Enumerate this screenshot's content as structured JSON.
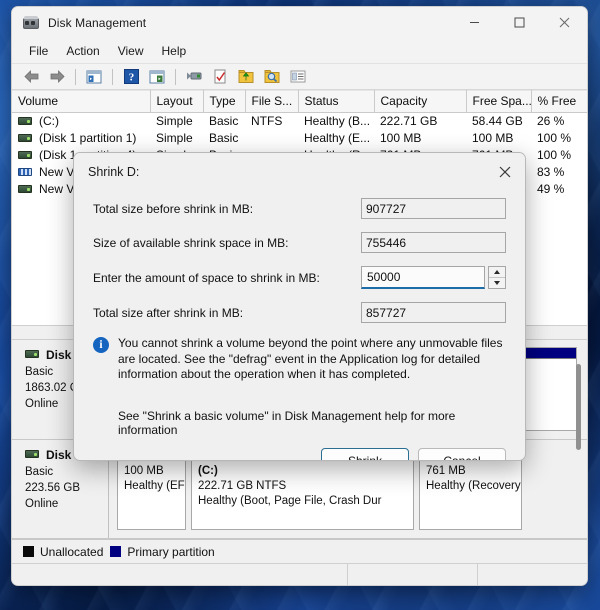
{
  "window": {
    "title": "Disk Management",
    "icon": "disk-management-icon",
    "controls": {
      "minimize": "minimize-icon",
      "maximize": "maximize-icon",
      "close": "close-icon"
    }
  },
  "menubar": {
    "items": [
      "File",
      "Action",
      "View",
      "Help"
    ]
  },
  "toolbar": {
    "buttons": [
      {
        "name": "back-icon"
      },
      {
        "name": "forward-icon"
      },
      {
        "name": "separator"
      },
      {
        "name": "show-hide-console-tree-icon"
      },
      {
        "name": "separator"
      },
      {
        "name": "help-icon"
      },
      {
        "name": "show-hide-action-pane-icon"
      },
      {
        "name": "separator"
      },
      {
        "name": "properties-icon"
      },
      {
        "name": "refresh-icon"
      },
      {
        "name": "rescan-disks-icon"
      },
      {
        "name": "search-icon"
      },
      {
        "name": "list-view-icon"
      }
    ]
  },
  "volume_list": {
    "columns": [
      "Volume",
      "Layout",
      "Type",
      "File S...",
      "Status",
      "Capacity",
      "Free Spa...",
      "% Free"
    ],
    "rows": [
      {
        "volume": "(C:)",
        "icon": "volume-icon",
        "layout": "Simple",
        "type": "Basic",
        "filesystem": "NTFS",
        "status": "Healthy (B...",
        "capacity": "222.71 GB",
        "free_space": "58.44 GB",
        "percent_free": "26 %"
      },
      {
        "volume": "(Disk 1 partition 1)",
        "icon": "volume-icon",
        "layout": "Simple",
        "type": "Basic",
        "filesystem": "",
        "status": "Healthy (E...",
        "capacity": "100 MB",
        "free_space": "100 MB",
        "percent_free": "100 %"
      },
      {
        "volume": "(Disk 1 partition 4)",
        "icon": "volume-icon",
        "layout": "Simple",
        "type": "Basic",
        "filesystem": "",
        "status": "Healthy (R...",
        "capacity": "761 MB",
        "free_space": "761 MB",
        "percent_free": "100 %"
      },
      {
        "volume": "New Vol",
        "icon": "volume-icon-striped",
        "layout": "",
        "type": "",
        "filesystem": "",
        "status": "",
        "capacity": "",
        "free_space": "",
        "percent_free": "83 %"
      },
      {
        "volume": "New Vol",
        "icon": "volume-icon",
        "layout": "",
        "type": "",
        "filesystem": "",
        "status": "",
        "capacity": "",
        "free_space": "",
        "percent_free": "49 %"
      }
    ]
  },
  "disk_view": {
    "disks": [
      {
        "name": "Disk 0",
        "type": "Basic",
        "size": "1863.02 GB",
        "state": "Online",
        "partitions": []
      },
      {
        "name": "Disk 1",
        "type": "Basic",
        "size": "223.56 GB",
        "state": "Online",
        "partitions": [
          {
            "label": "",
            "size": "100 MB",
            "status": "Healthy (EF",
            "kind": "primary"
          },
          {
            "label": "(C:)",
            "size": "222.71 GB NTFS",
            "status": "Healthy (Boot, Page File, Crash Dur",
            "kind": "primary"
          },
          {
            "label": "",
            "size": "761 MB",
            "status": "Healthy (Recovery",
            "kind": "primary"
          }
        ]
      }
    ]
  },
  "legend": {
    "items": [
      {
        "label": "Unallocated",
        "swatch": "unallocated",
        "color": "#0a0a0a"
      },
      {
        "label": "Primary partition",
        "swatch": "primary",
        "color": "#000080"
      }
    ]
  },
  "dialog": {
    "title": "Shrink D:",
    "close_icon": "close-icon",
    "fields": [
      {
        "label": "Total size before shrink in MB:",
        "value": "907727",
        "readonly": true
      },
      {
        "label": "Size of available shrink space in MB:",
        "value": "755446",
        "readonly": true
      },
      {
        "label": "Enter the amount of space to shrink in MB:",
        "value": "50000",
        "readonly": false
      },
      {
        "label": "Total size after shrink in MB:",
        "value": "857727",
        "readonly": true
      }
    ],
    "info_icon": "info-icon",
    "info_text": "You cannot shrink a volume beyond the point where any unmovable files are located. See the \"defrag\" event in the Application log for detailed information about the operation when it has completed.",
    "help_text": "See \"Shrink a basic volume\" in Disk Management help for more information",
    "buttons": {
      "primary": "Shrink",
      "secondary": "Cancel"
    }
  },
  "colors": {
    "primary_partition": "#000080",
    "unallocated": "#0a0a0a",
    "focus_border": "#2a6e92",
    "input_underline": "#1d6ea8",
    "info_blue": "#1565c0"
  }
}
